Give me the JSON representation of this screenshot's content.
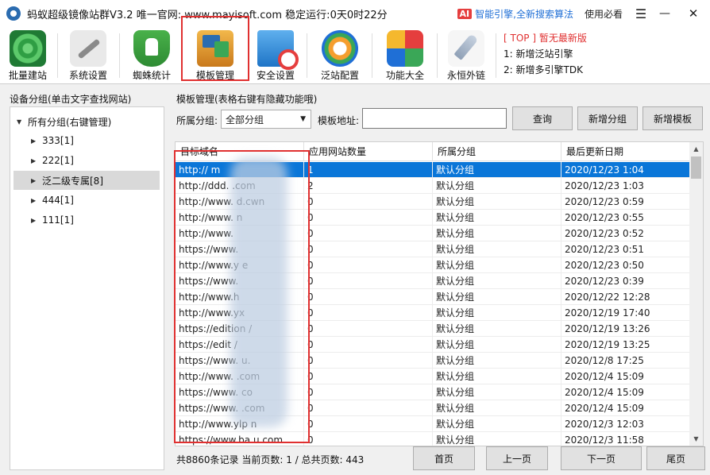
{
  "titlebar": {
    "title": "蚂蚁超级镜像站群V3.2  唯一官网: www.mayisoft.com 稳定运行:0天0时22分",
    "ai_badge": "AI",
    "ai_text": "智能引擎,全新搜索算法",
    "must_read": "使用必看",
    "menu_glyph": "☰",
    "min_glyph": "—",
    "close_glyph": "✕"
  },
  "toolbar": {
    "items": [
      {
        "label": "批量建站",
        "icon": "radar-icon"
      },
      {
        "label": "系统设置",
        "icon": "wrench-icon"
      },
      {
        "label": "蜘蛛统计",
        "icon": "shield-horse-icon"
      },
      {
        "label": "模板管理",
        "icon": "template-icon"
      },
      {
        "label": "安全设置",
        "icon": "security-icon"
      },
      {
        "label": "泛站配置",
        "icon": "globe-icon"
      },
      {
        "label": "功能大全",
        "icon": "grid-icon"
      },
      {
        "label": "永恒外链",
        "icon": "rocket-icon"
      }
    ],
    "notice_top": "[ TOP ] 暂无最新版",
    "notice_1": "1:  新增泛站引擎",
    "notice_2": "2:  新增多引擎TDK",
    "active_color": "#e03030"
  },
  "left": {
    "title": "设备分组(单击文字查找网站)",
    "root": "所有分组(右键管理)",
    "groups": [
      "333[1]",
      "222[1]",
      "泛二级专属[8]",
      "444[1]",
      "111[1]"
    ],
    "selected_index": 2
  },
  "right": {
    "title": "模板管理(表格右键有隐藏功能哦)",
    "group_label": "所属分组:",
    "group_value": "全部分组",
    "url_label": "模板地址:",
    "query_button": "查询",
    "add_group_button": "新增分组",
    "add_template_button": "新增模板"
  },
  "table": {
    "headers": [
      "目标域名",
      "应用网站数量",
      "所属分组",
      "最后更新日期"
    ],
    "rows": [
      [
        "http://         m",
        "1",
        "默认分组",
        "2020/12/23 1:04"
      ],
      [
        "http://ddd.     .com",
        "2",
        "默认分组",
        "2020/12/23 1:03"
      ],
      [
        "http://www.      d.cwn",
        "0",
        "默认分组",
        "2020/12/23 0:59"
      ],
      [
        "http://www.        n",
        "0",
        "默认分组",
        "2020/12/23 0:55"
      ],
      [
        "http://www.         ",
        "0",
        "默认分组",
        "2020/12/23 0:52"
      ],
      [
        "https://www.        ",
        "0",
        "默认分组",
        "2020/12/23 0:51"
      ],
      [
        "http://www.y       e",
        "0",
        "默认分组",
        "2020/12/23 0:50"
      ],
      [
        "https://www.         ",
        "0",
        "默认分组",
        "2020/12/23 0:39"
      ],
      [
        "http://www.h         ",
        "0",
        "默认分组",
        "2020/12/22 12:28"
      ],
      [
        "http://www.yx        ",
        "0",
        "默认分组",
        "2020/12/19 17:40"
      ],
      [
        "https://edition      /",
        "0",
        "默认分组",
        "2020/12/19 13:26"
      ],
      [
        "https://edit         /",
        "0",
        "默认分组",
        "2020/12/19 13:25"
      ],
      [
        "https://www.       u.",
        "0",
        "默认分组",
        "2020/12/8 17:25"
      ],
      [
        "http://www.       .com",
        "0",
        "默认分组",
        "2020/12/4 15:09"
      ],
      [
        "https://www.      co",
        "0",
        "默认分组",
        "2020/12/4 15:09"
      ],
      [
        "https://www.      .com",
        "0",
        "默认分组",
        "2020/12/4 15:09"
      ],
      [
        "http://www.ylp   n",
        "0",
        "默认分组",
        "2020/12/3 12:03"
      ],
      [
        "https://www.ba   u.com",
        "0",
        "默认分组",
        "2020/12/3 11:58"
      ]
    ],
    "selected_row": 0,
    "selection_color": "#0a76d8"
  },
  "status": {
    "text": "共8860条记录  当前页数: 1 / 总共页数: 443"
  },
  "pager": {
    "first": "首页",
    "prev": "上一页",
    "next": "下一页",
    "last": "尾页"
  }
}
